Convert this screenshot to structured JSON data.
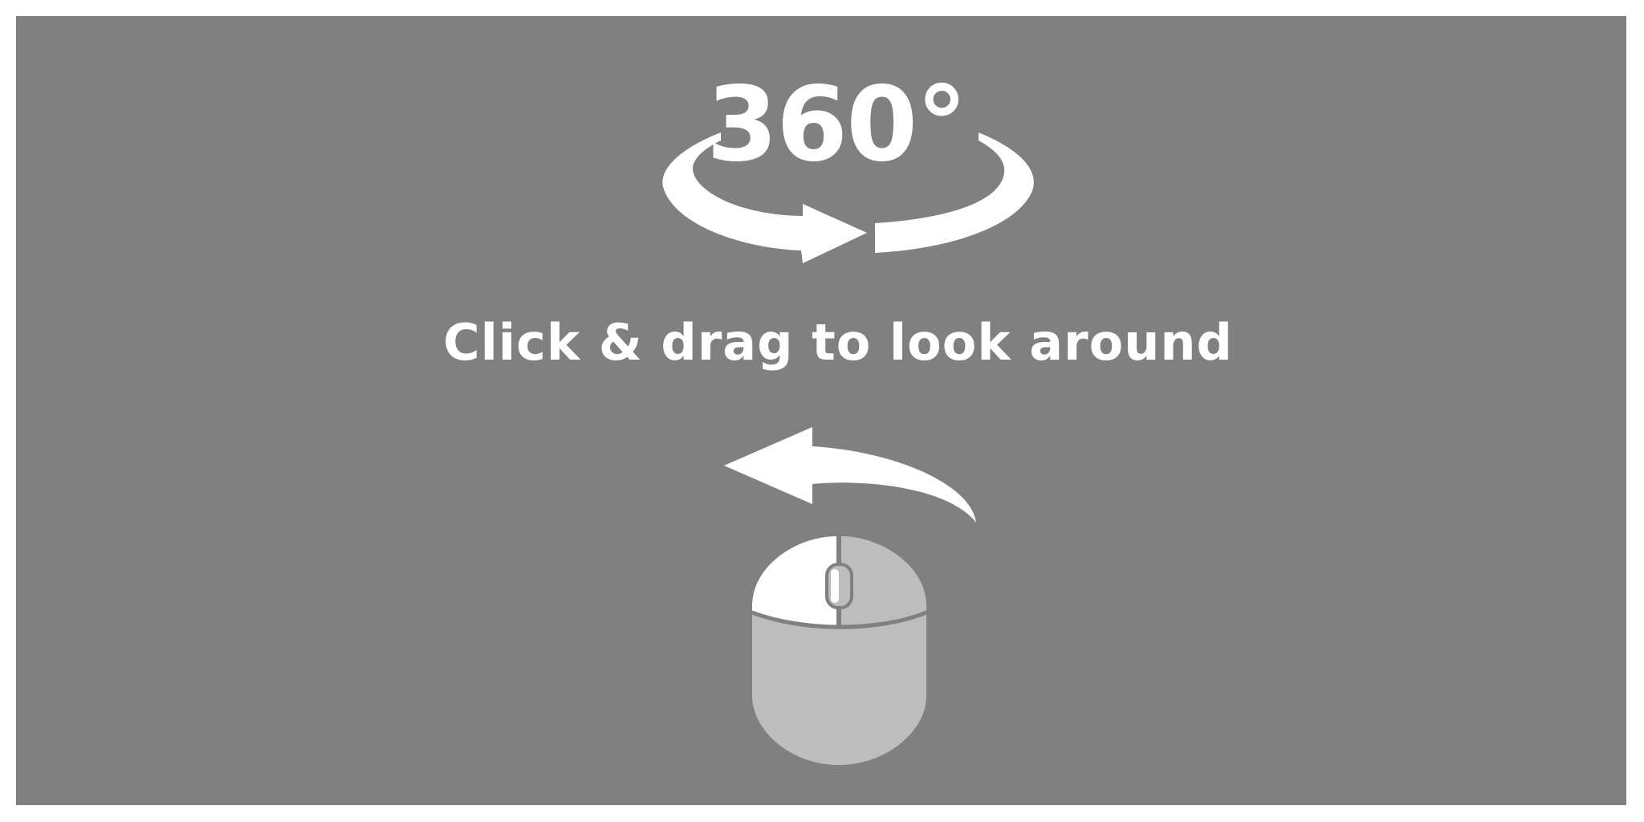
{
  "overlay": {
    "degree_label": "360°",
    "instruction": "Click & drag to look around"
  },
  "icons": {
    "rotate": "rotate-360-icon",
    "mouse": "mouse-left-drag-icon"
  },
  "colors": {
    "background": "#808080",
    "foreground": "#ffffff",
    "mouse_body": "#bdbdbd"
  }
}
